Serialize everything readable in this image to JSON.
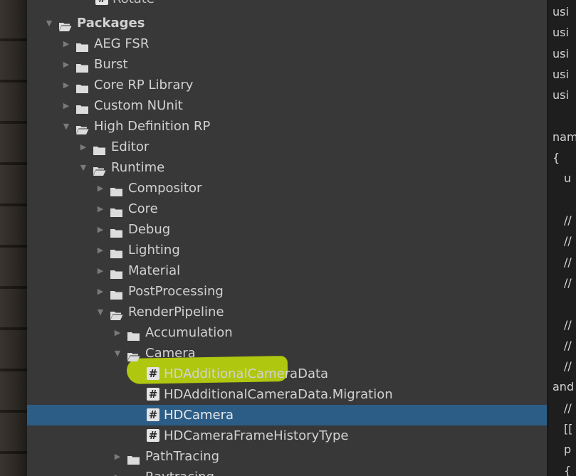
{
  "project_tree": {
    "partial_top_label": "Rotate",
    "items": [
      {
        "label": "Packages",
        "depth": 0,
        "kind": "folder",
        "expanded": true
      },
      {
        "label": "AEG FSR",
        "depth": 1,
        "kind": "folder",
        "expanded": false
      },
      {
        "label": "Burst",
        "depth": 1,
        "kind": "folder",
        "expanded": false
      },
      {
        "label": "Core RP Library",
        "depth": 1,
        "kind": "folder",
        "expanded": false
      },
      {
        "label": "Custom NUnit",
        "depth": 1,
        "kind": "folder",
        "expanded": false
      },
      {
        "label": "High Definition RP",
        "depth": 1,
        "kind": "folder",
        "expanded": true
      },
      {
        "label": "Editor",
        "depth": 2,
        "kind": "folder",
        "expanded": false
      },
      {
        "label": "Runtime",
        "depth": 2,
        "kind": "folder",
        "expanded": true
      },
      {
        "label": "Compositor",
        "depth": 3,
        "kind": "folder",
        "expanded": false
      },
      {
        "label": "Core",
        "depth": 3,
        "kind": "folder",
        "expanded": false
      },
      {
        "label": "Debug",
        "depth": 3,
        "kind": "folder",
        "expanded": false
      },
      {
        "label": "Lighting",
        "depth": 3,
        "kind": "folder",
        "expanded": false
      },
      {
        "label": "Material",
        "depth": 3,
        "kind": "folder",
        "expanded": false
      },
      {
        "label": "PostProcessing",
        "depth": 3,
        "kind": "folder",
        "expanded": false
      },
      {
        "label": "RenderPipeline",
        "depth": 3,
        "kind": "folder",
        "expanded": true
      },
      {
        "label": "Accumulation",
        "depth": 4,
        "kind": "folder",
        "expanded": false
      },
      {
        "label": "Camera",
        "depth": 4,
        "kind": "folder",
        "expanded": true
      },
      {
        "label": "HDAdditionalCameraData",
        "depth": 5,
        "kind": "script"
      },
      {
        "label": "HDAdditionalCameraData.Migration",
        "depth": 5,
        "kind": "script"
      },
      {
        "label": "HDCamera",
        "depth": 5,
        "kind": "script",
        "selected": true,
        "highlighted": true
      },
      {
        "label": "HDCameraFrameHistoryType",
        "depth": 5,
        "kind": "script"
      },
      {
        "label": "PathTracing",
        "depth": 4,
        "kind": "folder",
        "expanded": false
      },
      {
        "label": "Raytracing",
        "depth": 4,
        "kind": "folder",
        "expanded": false
      }
    ],
    "script_icon_glyph": "#",
    "colors": {
      "panel_bg": "#383838",
      "selected_bg": "#2c5d87",
      "highlighter": "#deff00",
      "text": "#d2d2d2"
    }
  },
  "code_editor": {
    "lines": [
      {
        "text": "usi",
        "indent": 0,
        "line": 1
      },
      {
        "text": "usi",
        "indent": 0,
        "line": 2
      },
      {
        "text": "usi",
        "indent": 0,
        "line": 3
      },
      {
        "text": "usi",
        "indent": 0,
        "line": 4
      },
      {
        "text": "usi",
        "indent": 0,
        "line": 5
      },
      {
        "text": "nam",
        "indent": 0,
        "line": 7
      },
      {
        "text": "{",
        "indent": 0,
        "line": 8
      },
      {
        "text": "u",
        "indent": 1,
        "line": 9
      },
      {
        "text": "//",
        "indent": 1,
        "line": 11
      },
      {
        "text": "//",
        "indent": 1,
        "line": 12
      },
      {
        "text": "//",
        "indent": 1,
        "line": 13
      },
      {
        "text": "//",
        "indent": 1,
        "line": 14
      },
      {
        "text": "//",
        "indent": 1,
        "line": 16
      },
      {
        "text": "//",
        "indent": 1,
        "line": 17
      },
      {
        "text": "//",
        "indent": 1,
        "line": 18
      },
      {
        "text": "and",
        "indent": 0,
        "line": 19
      },
      {
        "text": "//",
        "indent": 1,
        "line": 20
      },
      {
        "text": "[[",
        "indent": 1,
        "line": 21
      },
      {
        "text": "p",
        "indent": 1,
        "line": 22
      },
      {
        "text": "{",
        "indent": 1,
        "line": 23
      }
    ],
    "colors": {
      "bg": "#1e1e1e",
      "text": "#d4d4d4"
    }
  }
}
